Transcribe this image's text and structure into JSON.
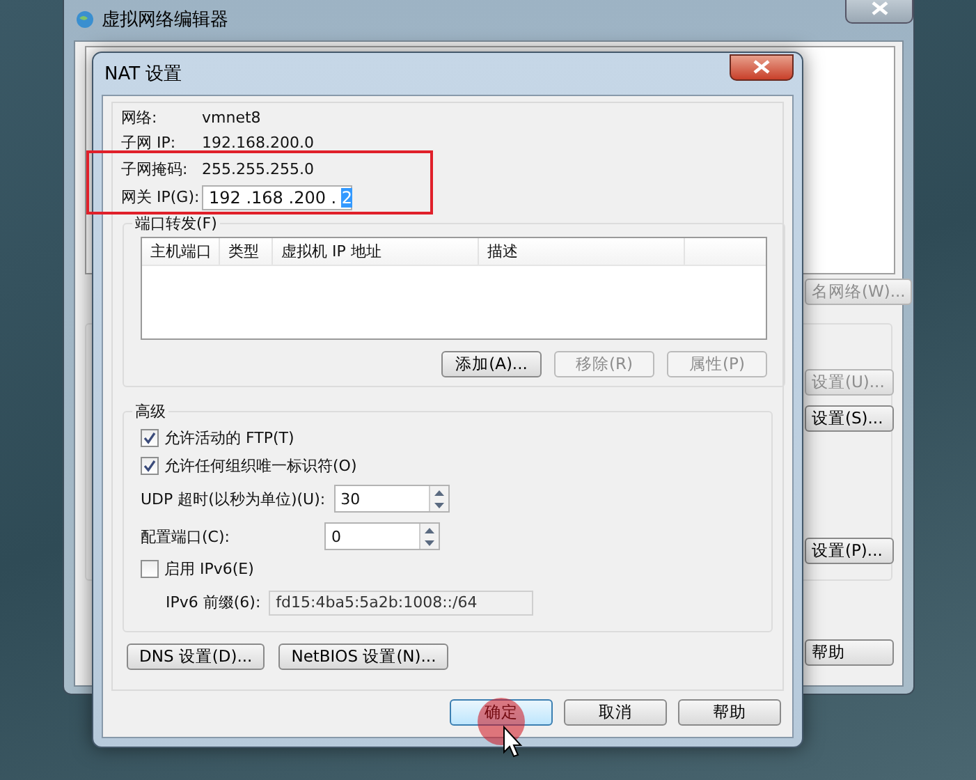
{
  "background_window": {
    "title": "虚拟网络编辑器",
    "buttons": [
      {
        "label": "名网络(W)...",
        "disabled": true
      },
      {
        "label": "设置(U)...",
        "disabled": true
      },
      {
        "label": "设置(S)...",
        "disabled": false
      },
      {
        "label": "设置(P)...",
        "disabled": false
      },
      {
        "label": "帮助",
        "disabled": false
      }
    ]
  },
  "dialog": {
    "title": "NAT 设置",
    "info": [
      {
        "label": "网络:",
        "value": "vmnet8"
      },
      {
        "label": "子网 IP:",
        "value": "192.168.200.0"
      },
      {
        "label": "子网掩码:",
        "value": "255.255.255.0"
      }
    ],
    "gateway": {
      "label": "网关 IP(G):",
      "value": "192 .168 .200 . ",
      "selected_text": "2"
    },
    "port_forwarding": {
      "title": "端口转发(F)",
      "columns": [
        "主机端口",
        "类型",
        "虚拟机 IP 地址",
        "描述"
      ],
      "buttons": [
        {
          "label": "添加(A)...",
          "disabled": false
        },
        {
          "label": "移除(R)",
          "disabled": true
        },
        {
          "label": "属性(P)",
          "disabled": true
        }
      ]
    },
    "advanced": {
      "title": "高级",
      "options": [
        {
          "kind": "checkbox",
          "label": "允许活动的 FTP(T)",
          "checked": true
        },
        {
          "kind": "checkbox",
          "label": "允许任何组织唯一标识符(O)",
          "checked": true
        },
        {
          "kind": "spinner",
          "label": "UDP 超时(以秒为单位)(U):",
          "value": "30"
        },
        {
          "kind": "spinner",
          "label": "配置端口(C):",
          "value": "0"
        },
        {
          "kind": "checkbox",
          "label": "启用 IPv6(E)",
          "checked": false
        },
        {
          "kind": "field",
          "label": "IPv6 前缀(6):",
          "value": "fd15:4ba5:5a2b:1008::/64",
          "disabled": true
        }
      ]
    },
    "extra_buttons": [
      {
        "label": "DNS 设置(D)..."
      },
      {
        "label": "NetBIOS 设置(N)..."
      }
    ],
    "buttons": [
      {
        "label": "确定",
        "default": true
      },
      {
        "label": "取消",
        "default": false
      },
      {
        "label": "帮助",
        "default": false
      }
    ]
  }
}
